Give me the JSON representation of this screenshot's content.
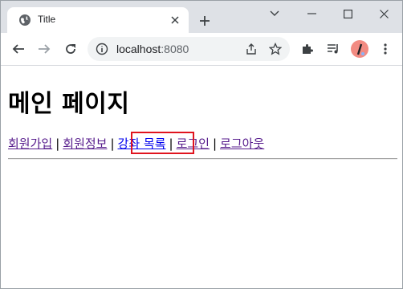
{
  "browser": {
    "tab": {
      "title": "Title"
    },
    "address_bar": {
      "host": "localhost",
      "port": ":8080"
    }
  },
  "page": {
    "heading": "메인 페이지",
    "nav": [
      {
        "label": "회원가입"
      },
      {
        "label": "회원정보"
      },
      {
        "label": "강좌 목록",
        "highlighted": true
      },
      {
        "label": "로그인"
      },
      {
        "label": "로그아웃"
      }
    ],
    "separator": "|",
    "highlight_color": "#e0141e"
  }
}
